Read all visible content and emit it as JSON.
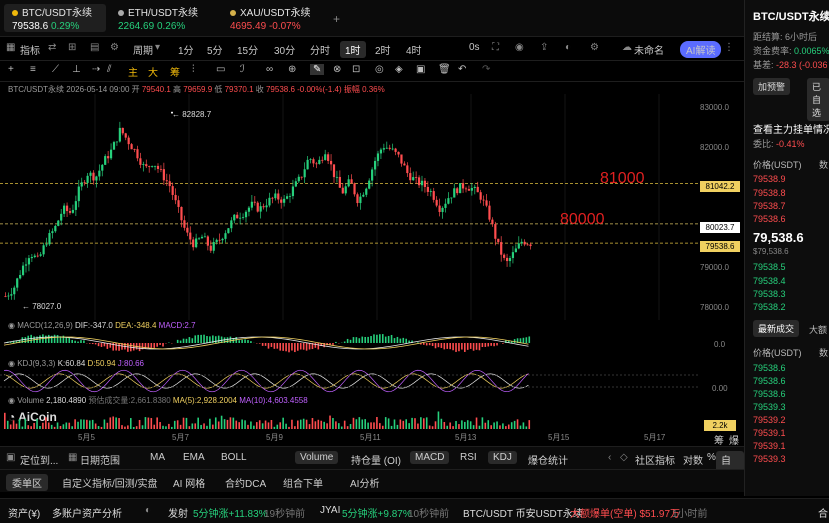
{
  "tabs": [
    {
      "symbol": "BTC/USDT永续",
      "price": "79538.6",
      "change": "0.29%",
      "dir": "up",
      "active": true
    },
    {
      "symbol": "ETH/USDT永续",
      "price": "2264.69",
      "change": "0.26%",
      "dir": "up",
      "active": false
    },
    {
      "symbol": "XAU/USDT永续",
      "price": "4695.49",
      "change": "-0.07%",
      "dir": "down",
      "active": false
    }
  ],
  "toolbar": {
    "indicators": "指标",
    "period": "周期",
    "intervals": [
      "1分",
      "5分",
      "15分",
      "30分",
      "分时",
      "1时",
      "2时",
      "4时"
    ],
    "active_interval": "1时",
    "zero_s": "0s",
    "unnamed": "未命名",
    "ai_label": "AI解读"
  },
  "drawing_tools": {
    "labels": [
      "主",
      "大",
      "筹"
    ]
  },
  "info_line": {
    "symbol": "BTC/USDT永续",
    "datetime": "2026-05-14 09:00",
    "open": "79540.1",
    "high": "79659.9",
    "low": "79370.1",
    "close": "79538.6",
    "change": "-0.00%(-1.4)",
    "amplitude": "振幅 0.36%"
  },
  "price_axis": [
    "83000.0",
    "82000.0",
    "81000.0",
    "80000.0",
    "79000.0",
    "78000.0"
  ],
  "price_tags": {
    "p81000": "81042.2",
    "p80000": "80023.7",
    "last": "79538.6"
  },
  "annotations": {
    "label_81000": "81000",
    "label_80000": "80000",
    "high_mark": "82828.7",
    "low_mark": "78027.0"
  },
  "chart_data": {
    "type": "candlestick",
    "symbol": "BTC/USDT永续",
    "interval": "1时",
    "x_labels": [
      "5月5",
      "5月7",
      "5月9",
      "5月11",
      "5月13",
      "5月15",
      "5月17"
    ],
    "ylim": [
      77600,
      83300
    ],
    "highest": 82828.7,
    "lowest": 78027.0,
    "last": 79538.6,
    "close_path": [
      78200,
      78400,
      78900,
      79300,
      79100,
      79600,
      79900,
      80400,
      80300,
      80900,
      81300,
      81200,
      81600,
      81900,
      82400,
      82100,
      81800,
      81400,
      81600,
      81300,
      81000,
      80400,
      79800,
      79500,
      79700,
      79400,
      79600,
      79900,
      80200,
      80300,
      80500,
      80400,
      80600,
      80700,
      80600,
      80900,
      81200,
      81700,
      81500,
      81900,
      81300,
      80800,
      81100,
      80600,
      81000,
      81600,
      82000,
      81900,
      81700,
      81300,
      81100,
      81000,
      80800,
      80400,
      80700,
      80900,
      81000,
      80900,
      80700,
      80200,
      79500,
      79000,
      79300,
      79600,
      79538.6
    ],
    "horizontal_lines": [
      81042.2,
      80023.7,
      79538.6
    ]
  },
  "macd": {
    "label": "MACD(12,26,9)",
    "dif": "DIF:-347.0",
    "dea": "DEA:-348.4",
    "macd": "MACD:2.7",
    "axis": "0.0"
  },
  "kdj": {
    "label": "KDJ(9,3,3)",
    "k": "K:60.84",
    "d": "D:50.94",
    "j": "J:80.66",
    "axis": "0.00"
  },
  "volume": {
    "label": "Volume",
    "value": "2,180.4890",
    "forecast": "预估成交量:2,661.8380",
    "ma5": "MA(5):2,928.2004",
    "ma10": "MA(10):4,603.4558",
    "tag": "2.2k"
  },
  "brand": "AiCoin",
  "scale_labels": [
    "筹",
    "爆"
  ],
  "bottom_bar1": [
    "定位到...",
    "日期范围",
    "MA",
    "EMA",
    "BOLL",
    "Volume",
    "持仓量 (OI)",
    "MACD",
    "RSI",
    "KDJ",
    "爆仓统计",
    "社区指标",
    "对数",
    "%",
    "自动"
  ],
  "bottom_bar2": [
    "委单区",
    "自定义指标/回测/实盘",
    "AI 网格",
    "合约DCA",
    "组合下单",
    "AI分析",
    "资产"
  ],
  "ticker_bar": {
    "account": "资产(¥)",
    "multi": "多账户资产分析",
    "item1_sym": "发射",
    "item1_val": "5分钟涨+11.83%",
    "item1_time": "19秒钟前",
    "item2_sym": "JYAI",
    "item2_val": "5分钟涨+9.87%",
    "item2_time": "10秒钟前",
    "item3_sym": "BTC/USDT 币安USDT永续",
    "item3_val": "大额爆单(空单) $51.97万",
    "item3_time": "1小时前",
    "item4": "合"
  },
  "right_panel": {
    "title": "BTC/USDT永续",
    "funding_label": "距结算",
    "funding_time": "6小时后",
    "rate_label": "资金费率",
    "rate_val": "0.0065%",
    "basis_label": "基差",
    "basis_val": "-28.3 (-0.036",
    "add_btn": "加预警",
    "added_btn": "已自选",
    "orderbook_title": "查看主力挂单情况",
    "diff_label": "委比",
    "diff_val": "-0.41%",
    "col_price": "价格(USDT)",
    "col_qty": "数",
    "asks": [
      "79538.9",
      "79538.8",
      "79538.7",
      "79538.6"
    ],
    "last_price": "79,538.6",
    "last_sub": "$79,538.6",
    "bids": [
      "79538.5",
      "79538.4",
      "79538.3",
      "79538.2"
    ],
    "trades_tab": "最新成交",
    "big_tab": "大额",
    "trades_col": "价格(USDT)",
    "trades_qty": "数",
    "trades": [
      {
        "p": "79538.6",
        "s": "bid"
      },
      {
        "p": "79538.6",
        "s": "bid"
      },
      {
        "p": "79538.6",
        "s": "bid"
      },
      {
        "p": "79539.3",
        "s": "bid"
      },
      {
        "p": "79539.2",
        "s": "ask"
      },
      {
        "p": "79539.1",
        "s": "ask"
      },
      {
        "p": "79539.1",
        "s": "ask"
      },
      {
        "p": "79539.3",
        "s": "ask"
      }
    ]
  },
  "colors": {
    "up": "#26d07c",
    "down": "#ff4d4f",
    "accent": "#f0b90b",
    "line_label": "#e02020"
  }
}
